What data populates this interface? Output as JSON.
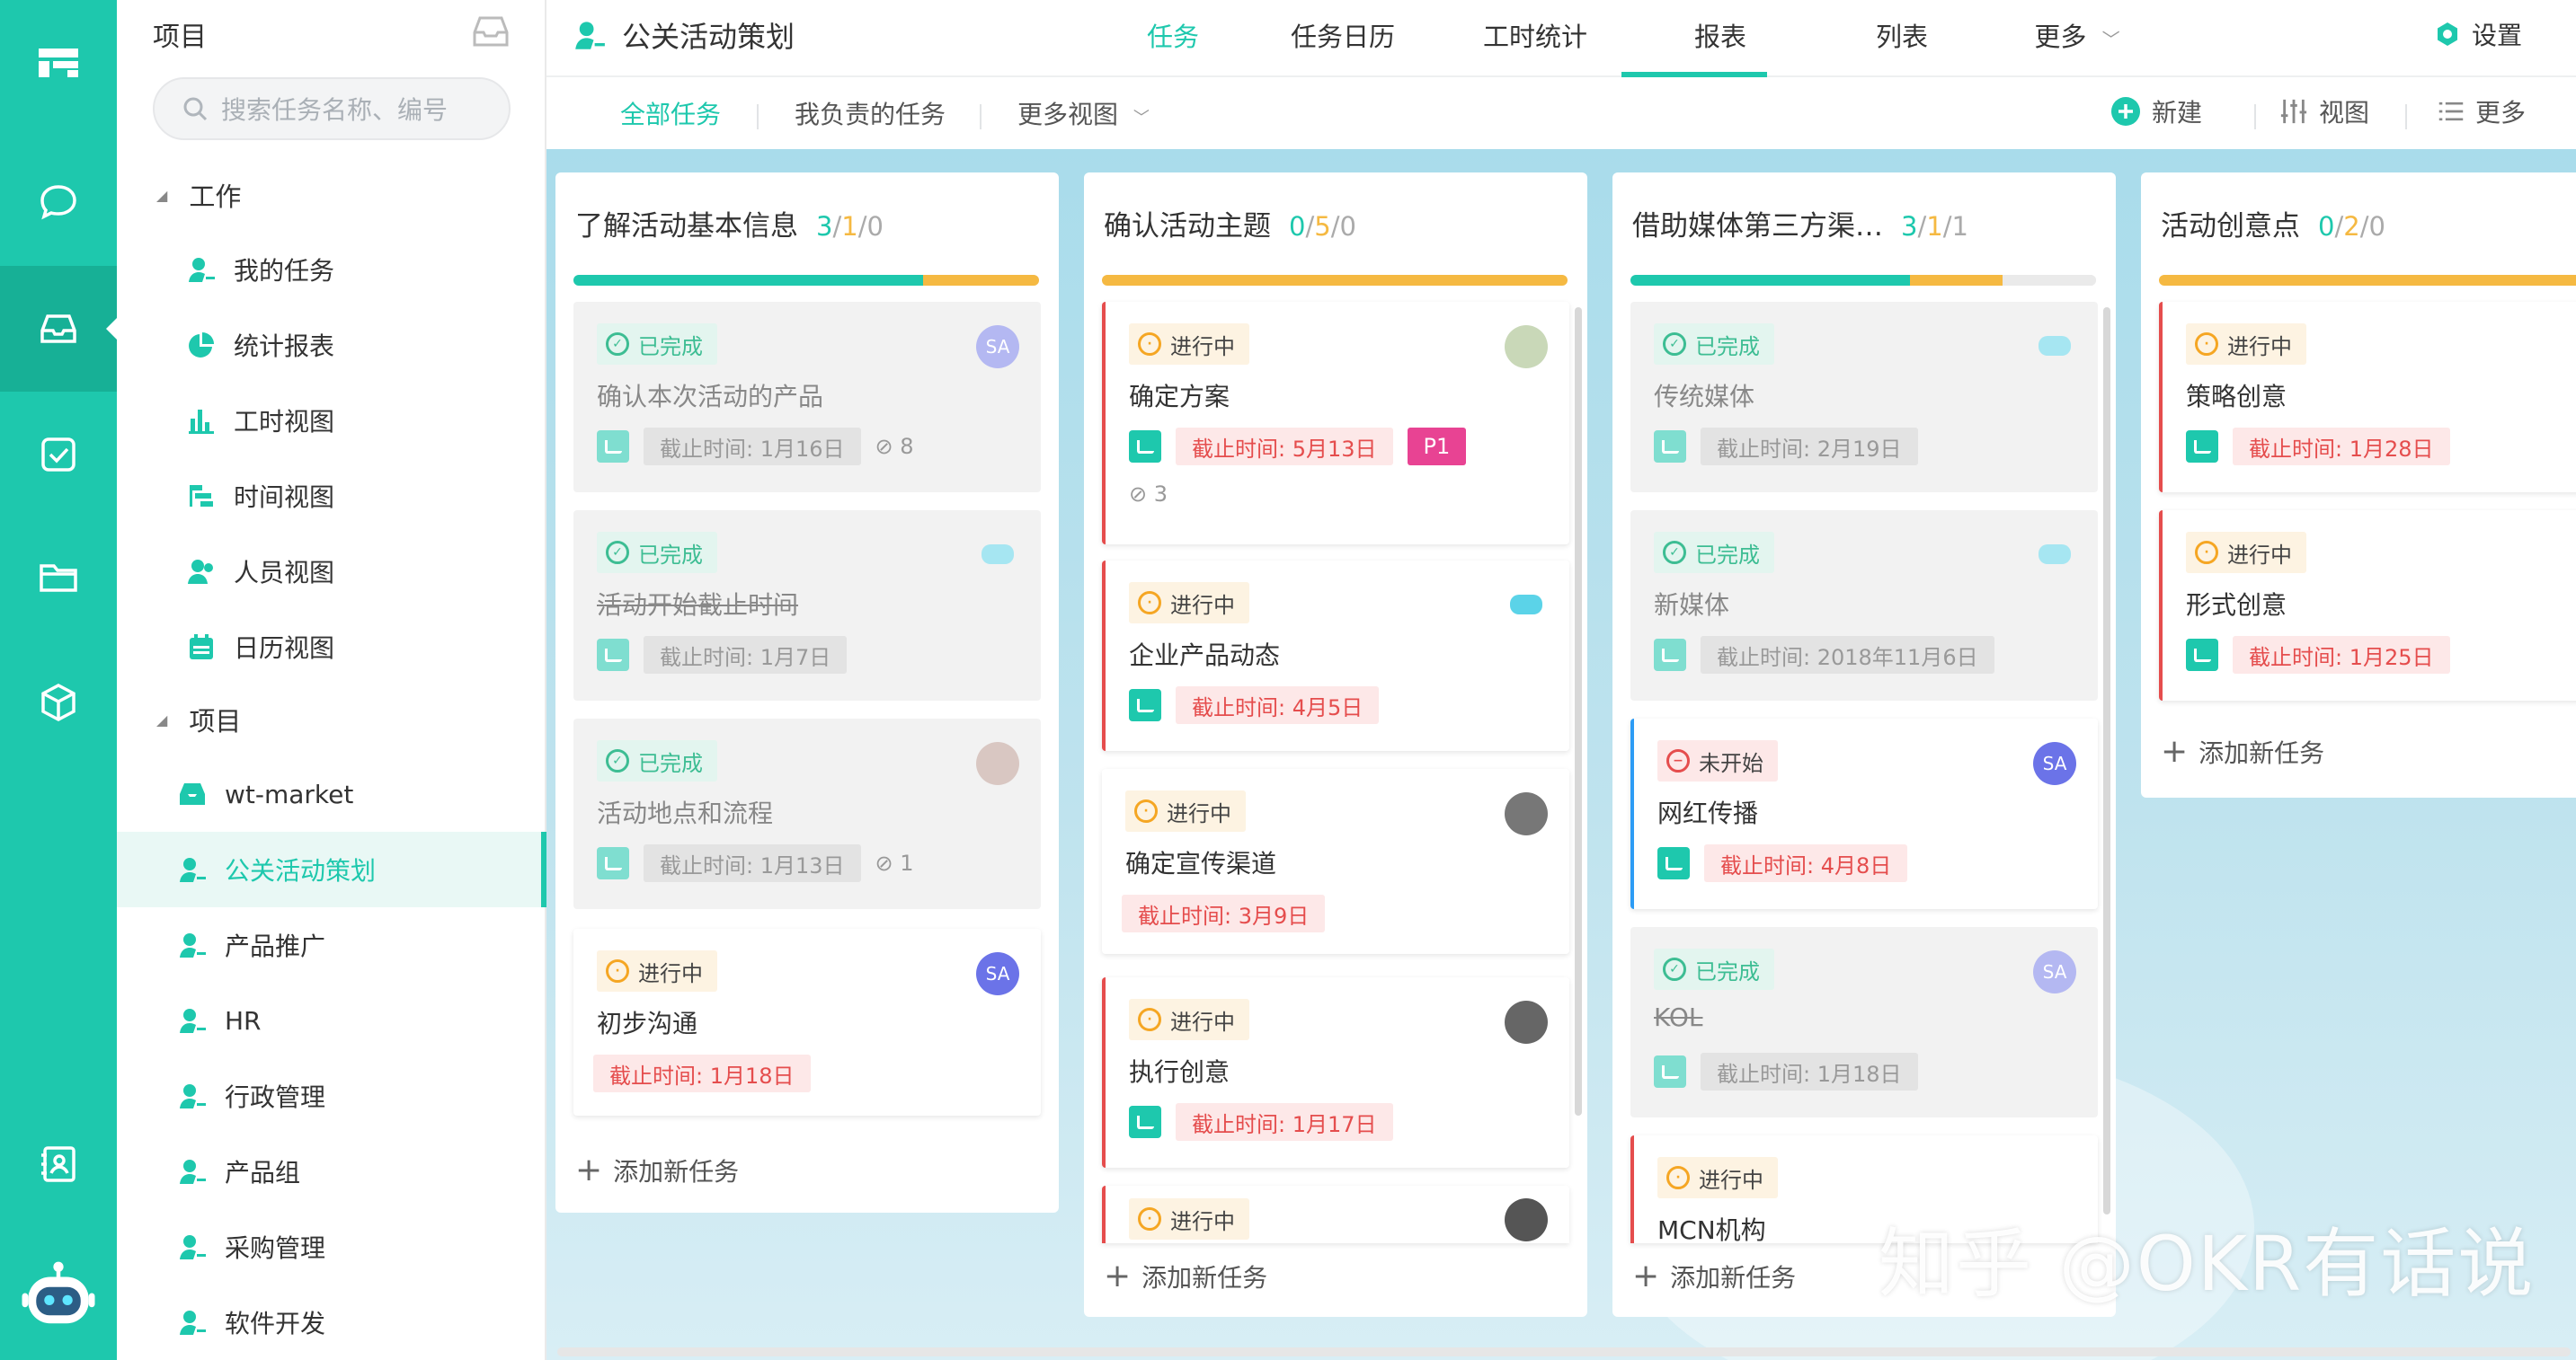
{
  "sidebar": {
    "title": "项目",
    "search_placeholder": "搜索任务名称、编号",
    "sections": [
      {
        "label": "工作",
        "items": [
          "我的任务",
          "统计报表",
          "工时视图",
          "时间视图",
          "人员视图",
          "日历视图"
        ]
      },
      {
        "label": "项目",
        "items": [
          "wt-market",
          "公关活动策划",
          "产品推广",
          "HR",
          "行政管理",
          "产品组",
          "采购管理",
          "软件开发"
        ]
      }
    ],
    "selected": "公关活动策划"
  },
  "header": {
    "project_title": "公关活动策划",
    "tabs": [
      "任务",
      "任务日历",
      "工时统计",
      "报表",
      "列表",
      "更多"
    ],
    "active_tab": "任务",
    "settings": "设置"
  },
  "subbar": {
    "views": [
      "全部任务",
      "我负责的任务",
      "更多视图"
    ],
    "new": "新建",
    "view": "视图",
    "more": "更多"
  },
  "columns": [
    {
      "title": "了解活动基本信息",
      "done": "3",
      "ing": "1",
      "todo": "0",
      "progress": [
        0.75,
        0.25,
        0
      ],
      "cards": [
        {
          "status": "已完成",
          "title": "确认本次活动的产品",
          "due": "截止时间: 1月16日",
          "attach": "8",
          "avatar": "SA"
        },
        {
          "status": "已完成",
          "title": "活动开始截止时间",
          "due": "截止时间: 1月7日"
        },
        {
          "status": "已完成",
          "title": "活动地点和流程",
          "due": "截止时间: 1月13日",
          "attach": "1"
        },
        {
          "status": "进行中",
          "title": "初步沟通",
          "due": "截止时间: 1月18日",
          "avatar": "SA"
        }
      ],
      "add": "添加新任务"
    },
    {
      "title": "确认活动主题",
      "done": "0",
      "ing": "5",
      "todo": "0",
      "progress": [
        0,
        1,
        0
      ],
      "cards": [
        {
          "status": "进行中",
          "title": "确定方案",
          "due": "截止时间: 5月13日",
          "priority": "P1",
          "attach": "3"
        },
        {
          "status": "进行中",
          "title": "企业产品动态",
          "due": "截止时间: 4月5日"
        },
        {
          "status": "进行中",
          "title": "确定宣传渠道",
          "due": "截止时间: 3月9日"
        },
        {
          "status": "进行中",
          "title": "执行创意",
          "due": "截止时间: 1月17日"
        },
        {
          "status": "进行中"
        }
      ],
      "add": "添加新任务"
    },
    {
      "title": "借助媒体第三方渠…",
      "done": "3",
      "ing": "1",
      "todo": "1",
      "progress": [
        0.6,
        0.2,
        0.2
      ],
      "cards": [
        {
          "status": "已完成",
          "title": "传统媒体",
          "due": "截止时间: 2月19日"
        },
        {
          "status": "已完成",
          "title": "新媒体",
          "due": "截止时间: 2018年11月6日"
        },
        {
          "status": "未开始",
          "title": "网红传播",
          "due": "截止时间: 4月8日",
          "avatar": "SA"
        },
        {
          "status": "已完成",
          "title": "KOL",
          "due": "截止时间: 1月18日",
          "avatar": "SA"
        },
        {
          "status": "进行中",
          "title": "MCN机构"
        }
      ],
      "add": "添加新任务"
    },
    {
      "title": "活动创意点",
      "done": "0",
      "ing": "2",
      "todo": "0",
      "progress": [
        0,
        1,
        0
      ],
      "cards": [
        {
          "status": "进行中",
          "title": "策略创意",
          "due": "截止时间: 1月28日"
        },
        {
          "status": "进行中",
          "title": "形式创意",
          "due": "截止时间: 1月25日"
        }
      ],
      "add": "添加新任务"
    }
  ],
  "watermark": "知乎 @OKR有话说",
  "colors": {
    "accent": "#1ec8ad",
    "done_green": "#3dbd93",
    "progress_orange": "#f5b942",
    "due_red": "#e54d4d",
    "priority_pink": "#e84393"
  }
}
